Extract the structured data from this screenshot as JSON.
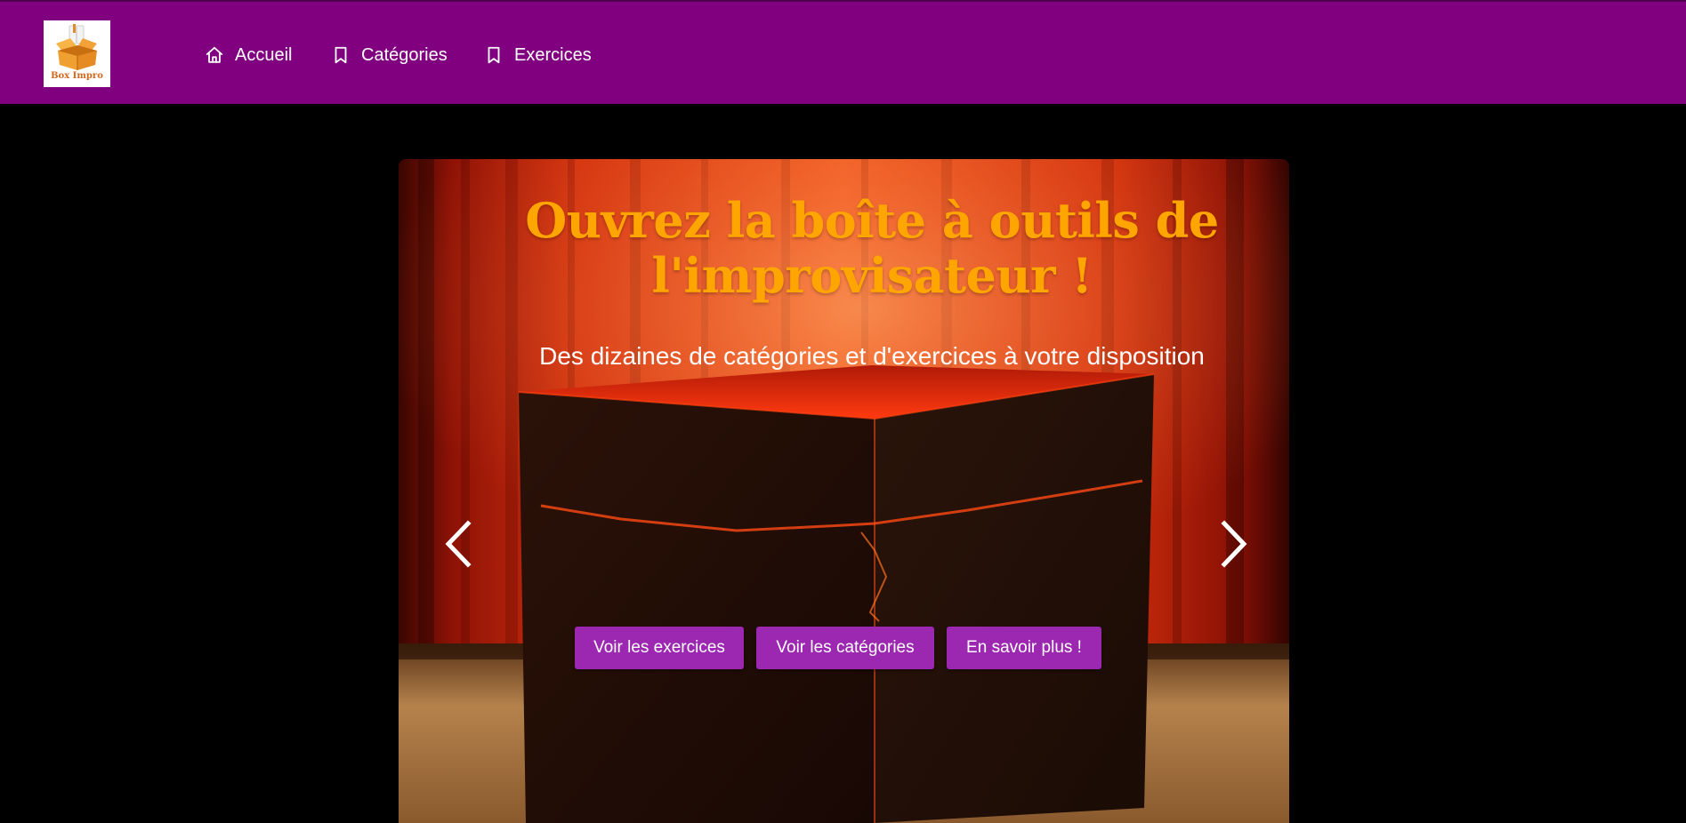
{
  "brand": {
    "logo_text": "Box Impro",
    "logo_icon": "open-box-icon"
  },
  "nav": {
    "items": [
      {
        "label": "Accueil",
        "icon": "home-icon"
      },
      {
        "label": "Catégories",
        "icon": "bookmark-icon"
      },
      {
        "label": "Exercices",
        "icon": "bookmark-icon"
      }
    ]
  },
  "hero": {
    "title": "Ouvrez la boîte à outils de l'improvisateur !",
    "subtitle": "Des dizaines de catégories et d'exercices à votre disposition",
    "prev_icon": "chevron-left-icon",
    "next_icon": "chevron-right-icon",
    "buttons": [
      {
        "label": "Voir les exercices"
      },
      {
        "label": "Voir les catégories"
      },
      {
        "label": "En savoir plus !"
      }
    ]
  },
  "colors": {
    "navbar": "#800080",
    "button": "#9c27b0",
    "title": "#ffa500",
    "page_background": "#000000"
  }
}
